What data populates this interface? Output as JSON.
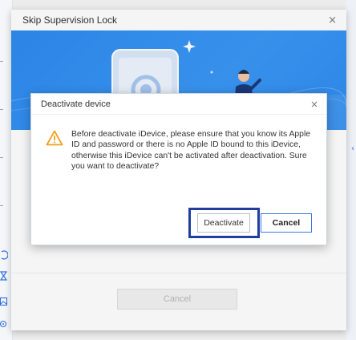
{
  "main_window": {
    "title": "Skip Supervision Lock",
    "close_glyph": "×",
    "cancel_label": "Cancel"
  },
  "dialog": {
    "title": "Deactivate device",
    "close_glyph": "×",
    "message": "Before deactivate iDevice, please ensure that you know its Apple ID and password or there is no Apple ID bound to this iDevice, otherwise this iDevice can't be activated after deactivation. Sure you want to deactivate?",
    "deactivate_label": "Deactivate",
    "cancel_label": "Cancel"
  },
  "icons": {
    "warning": "warning-triangle-icon",
    "close": "close-icon",
    "sparkle": "sparkle-icon",
    "phone": "phone-illustration",
    "person": "person-illustration",
    "back_arrow": "chevron-left-icon"
  },
  "colors": {
    "hero_blue": "#2f8cf0",
    "highlight_outline": "#1f3e9e",
    "primary_border": "#3a78e6",
    "warning": "#f0a020"
  }
}
